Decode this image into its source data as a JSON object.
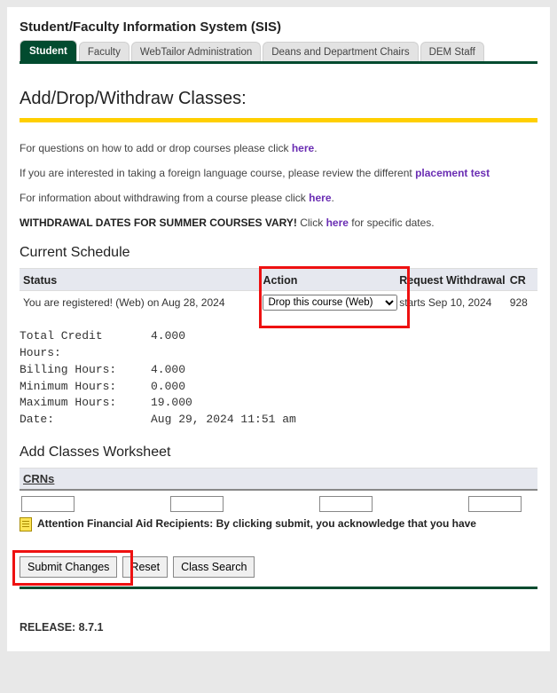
{
  "header": {
    "title": "Student/Faculty Information System (SIS)",
    "tabs": [
      {
        "label": "Student",
        "active": true
      },
      {
        "label": "Faculty",
        "active": false
      },
      {
        "label": "WebTailor Administration",
        "active": false
      },
      {
        "label": "Deans and Department Chairs",
        "active": false
      },
      {
        "label": "DEM Staff",
        "active": false
      }
    ]
  },
  "page_heading": "Add/Drop/Withdraw Classes:",
  "info": {
    "line1_pre": "For questions on how to add or drop courses please click ",
    "line1_link": "here",
    "line1_post": ".",
    "line2_pre": "If you are interested in taking a foreign language course, please review the different ",
    "line2_link": "placement test",
    "line3_pre": "For information about withdrawing from a course please click ",
    "line3_link": "here",
    "line3_post": ".",
    "line4_bold": "WITHDRAWAL DATES FOR SUMMER COURSES VARY!",
    "line4_mid": " Click ",
    "line4_link": "here",
    "line4_post": " for specific dates."
  },
  "schedule": {
    "heading": "Current Schedule",
    "columns": {
      "status": "Status",
      "action": "Action",
      "request": "Request Withdrawal",
      "cr": "CR"
    },
    "row": {
      "status": "You are registered! (Web) on Aug 28, 2024",
      "action_selected": "Drop this course (Web)",
      "request": "starts Sep 10, 2024",
      "cr": "928"
    }
  },
  "hours": {
    "total_label": "Total Credit Hours:",
    "total_value": "4.000",
    "billing_label": "Billing Hours:",
    "billing_value": "4.000",
    "min_label": "Minimum Hours:",
    "min_value": "0.000",
    "max_label": "Maximum Hours:",
    "max_value": "19.000",
    "date_label": "Date:",
    "date_value": "Aug 29, 2024 11:51 am"
  },
  "worksheet": {
    "heading": "Add Classes Worksheet",
    "crns_label": "CRNs",
    "attention": "Attention Financial Aid Recipients: By clicking submit, you acknowledge that you have"
  },
  "buttons": {
    "submit": "Submit Changes",
    "reset": "Reset",
    "search": "Class Search"
  },
  "release_label": "RELEASE: 8.7.1"
}
